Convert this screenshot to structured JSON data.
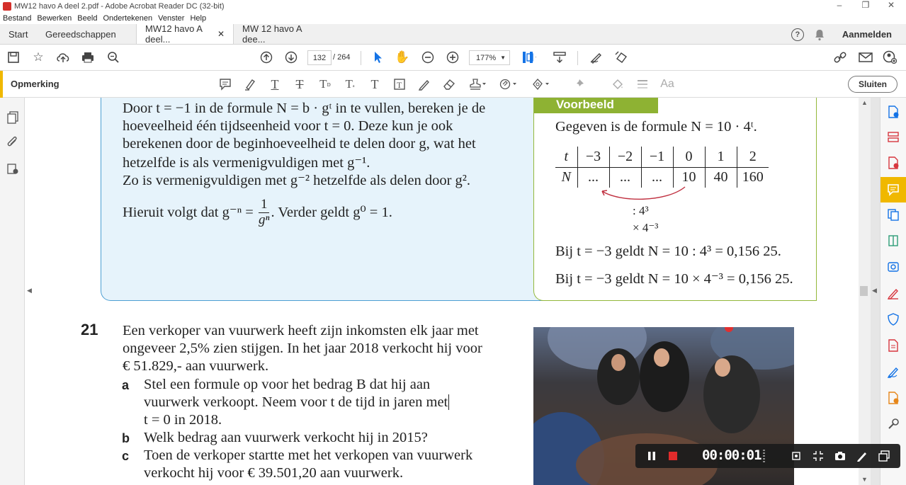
{
  "window": {
    "title": "MW12 havo A deel 2.pdf - Adobe Acrobat Reader DC (32-bit)",
    "controls": [
      "–",
      "❐",
      "✕"
    ]
  },
  "menu": [
    "Bestand",
    "Bewerken",
    "Beeld",
    "Ondertekenen",
    "Venster",
    "Help"
  ],
  "tabs": {
    "start": "Start",
    "tools": "Gereedschappen",
    "doc1": "MW12 havo A deel...",
    "doc1_close": "✕",
    "doc2": "MW 12 havo A dee...",
    "help": "?",
    "signin": "Aanmelden"
  },
  "toolbar": {
    "page_current": "132",
    "page_total": "/  264",
    "zoom": "177%"
  },
  "comment": {
    "title": "Opmerking",
    "close": "Sluiten",
    "text_tool_label": "Aa"
  },
  "doc": {
    "blue": {
      "lines": [
        "Door t = −1 in de formule N = b · gᵗ in te vullen, bereken je de",
        "hoeveelheid één tijdseenheid voor t = 0. Deze kun je ook",
        "berekenen door de beginhoeveelheid te delen door g, wat het",
        "hetzelfde is als vermenigvuldigen met g⁻¹.",
        "Zo is vermenigvuldigen met g⁻² hetzelfde als delen door g²."
      ],
      "last_line_pre": "Hieruit volgt dat g⁻ⁿ =",
      "frac_num": "1",
      "frac_den": "gⁿ",
      "last_line_post": ". Verder geldt g⁰ = 1."
    },
    "example": {
      "label": "Voorbeeld",
      "intro": "Gegeven is de formule N = 10 · 4ᵗ.",
      "table": {
        "row_t": [
          "t",
          "−3",
          "−2",
          "−1",
          "0",
          "1",
          "2"
        ],
        "row_n": [
          "N",
          "...",
          "...",
          "...",
          "10",
          "40",
          "160"
        ]
      },
      "div_label": ": 4³",
      "mul_label": "× 4⁻³",
      "line1": "Bij t = −3 geldt N = 10 : 4³ = 0,156 25.",
      "line2": "Bij t = −3 geldt N = 10 × 4⁻³ = 0,156 25."
    },
    "question": {
      "number": "21",
      "intro": [
        "Een verkoper van vuurwerk heeft zijn inkomsten elk jaar met",
        "ongeveer 2,5% zien stijgen. In het jaar 2018 verkocht hij voor",
        "€ 51.829,- aan vuurwerk."
      ],
      "a_label": "a",
      "a_lines": [
        "Stel een formule op voor het bedrag B dat hij aan",
        "vuurwerk verkoopt. Neem voor t de tijd in jaren met",
        "t = 0 in 2018."
      ],
      "b_label": "b",
      "b_lines": [
        "Welk bedrag aan vuurwerk verkocht hij in 2015?"
      ],
      "c_label": "c",
      "c_lines": [
        "Toen de verkoper startte met het verkopen van vuurwerk",
        "verkocht hij voor € 39.501,20 aan vuurwerk."
      ]
    }
  },
  "recorder": {
    "time": "00:00:01"
  },
  "colors": {
    "accent": "#f0b800",
    "blue_box_bg": "#e6f3fb",
    "blue_box_border": "#4d9fd3",
    "example_green": "#8eb233",
    "right_panel_icons": [
      "#1473e6",
      "#d7373f",
      "#d7373f",
      "#f0b800",
      "#1473e6",
      "#2d9d78",
      "#1473e6",
      "#d7373f",
      "#1473e6",
      "#d7373f",
      "#1473e6",
      "#e68619",
      "#555555"
    ]
  }
}
